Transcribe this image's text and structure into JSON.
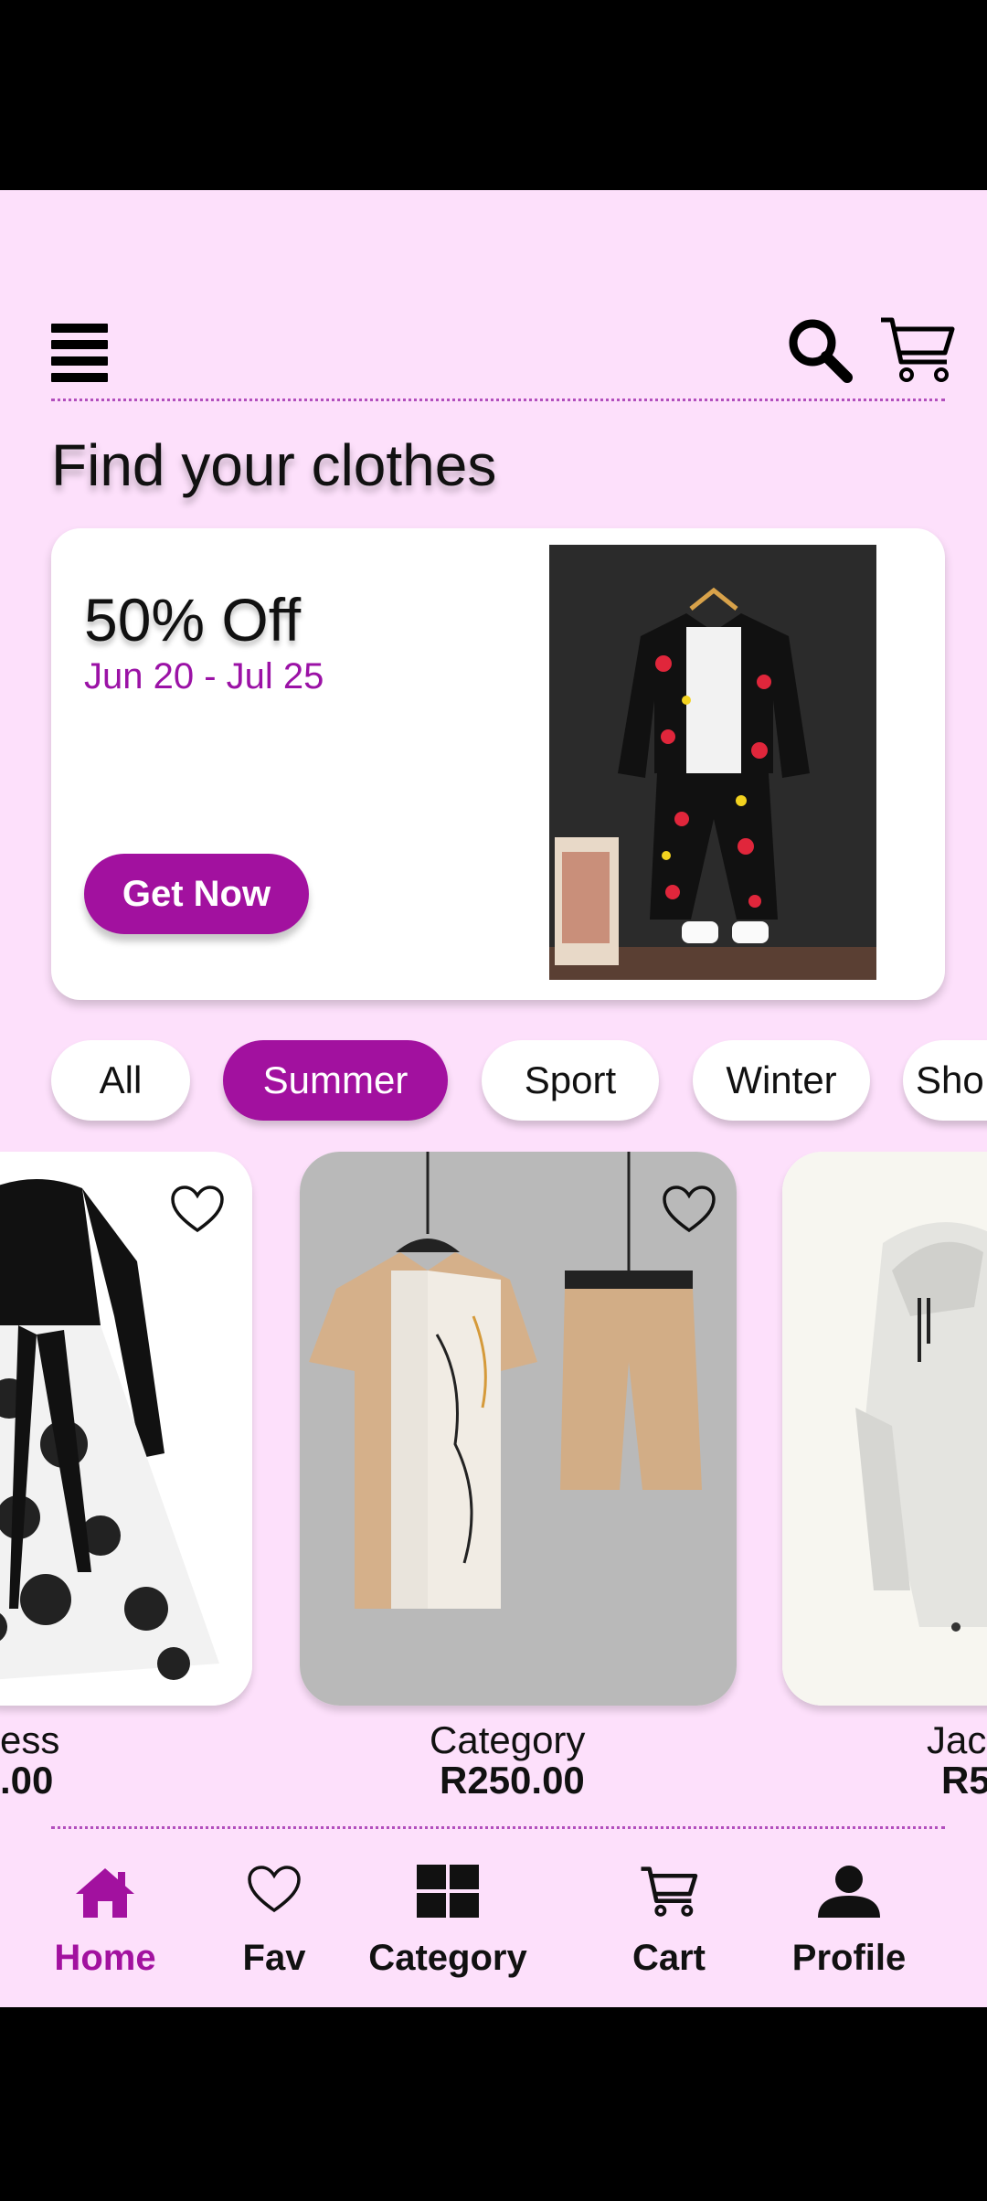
{
  "header": {
    "title": "Find your clothes"
  },
  "promo": {
    "title": "50% Off",
    "dates": "Jun 20 - Jul 25",
    "cta_label": "Get Now"
  },
  "categories": [
    {
      "label": "All",
      "active": false
    },
    {
      "label": "Summer",
      "active": true
    },
    {
      "label": "Sport",
      "active": false
    },
    {
      "label": "Winter",
      "active": false
    },
    {
      "label": "Sho",
      "active": false
    }
  ],
  "products": [
    {
      "name": "ess",
      "price": ".00"
    },
    {
      "name": "Category",
      "price": "R250.00"
    },
    {
      "name": "Jac",
      "price": "R5"
    }
  ],
  "bottom_nav": [
    {
      "label": "Home",
      "icon": "home-icon",
      "active": true
    },
    {
      "label": "Fav",
      "icon": "heart-icon",
      "active": false
    },
    {
      "label": "Category",
      "icon": "grid-icon",
      "active": false
    },
    {
      "label": "Cart",
      "icon": "cart-icon",
      "active": false
    },
    {
      "label": "Profile",
      "icon": "person-icon",
      "active": false
    }
  ],
  "colors": {
    "background": "#fde0fb",
    "accent": "#a2119f",
    "divider": "#b24fbd"
  }
}
